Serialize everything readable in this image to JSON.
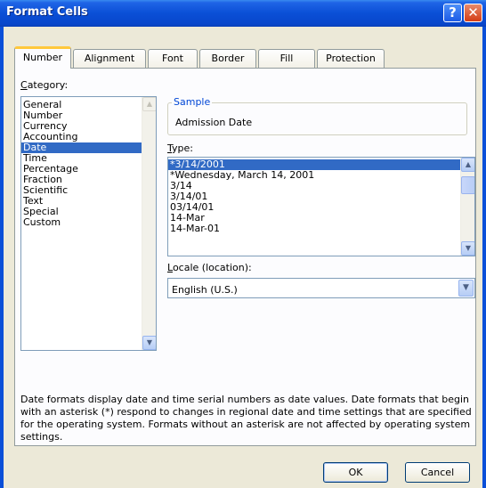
{
  "window": {
    "title": "Format Cells",
    "help": "?",
    "close": "✕"
  },
  "tabs": [
    "Number",
    "Alignment",
    "Font",
    "Border",
    "Fill",
    "Protection"
  ],
  "category": {
    "label_prefix": "C",
    "label_rest": "ategory:",
    "items": [
      "General",
      "Number",
      "Currency",
      "Accounting",
      "Date",
      "Time",
      "Percentage",
      "Fraction",
      "Scientific",
      "Text",
      "Special",
      "Custom"
    ],
    "selected": "Date"
  },
  "sample": {
    "title": "Sample",
    "value": "Admission Date"
  },
  "type": {
    "label_prefix": "T",
    "label_rest": "ype:",
    "items": [
      "*3/14/2001",
      "*Wednesday, March 14, 2001",
      "3/14",
      "3/14/01",
      "03/14/01",
      "14-Mar",
      "14-Mar-01"
    ],
    "selected": "*3/14/2001"
  },
  "locale": {
    "label_prefix": "L",
    "label_rest": "ocale (location):",
    "value": "English (U.S.)"
  },
  "description": "Date formats display date and time serial numbers as date values.  Date formats that begin with an asterisk (*) respond to changes in regional date and time settings that are specified for the operating system. Formats without an asterisk are not affected by operating system settings.",
  "buttons": {
    "ok": "OK",
    "cancel": "Cancel"
  },
  "colors": {
    "title_bar": "#0a4fd6",
    "selection": "#316ac5",
    "group_title": "#0046d5",
    "dialog_bg": "#ece9d8"
  }
}
